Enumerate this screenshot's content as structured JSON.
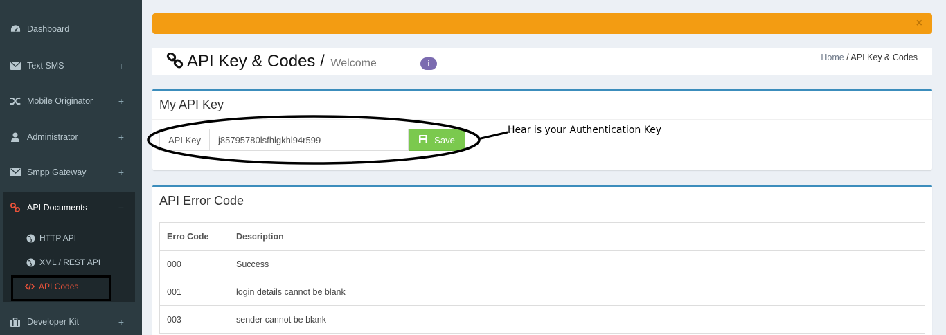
{
  "sidebar": {
    "items": [
      {
        "label": "Dashboard",
        "icon": "dashboard-icon"
      },
      {
        "label": "Text SMS",
        "icon": "envelope-icon",
        "toggle": "+"
      },
      {
        "label": "Mobile Originator",
        "icon": "shuffle-icon",
        "toggle": "+"
      },
      {
        "label": "Administrator",
        "icon": "user-icon",
        "toggle": "+"
      },
      {
        "label": "Smpp Gateway",
        "icon": "envelope-icon",
        "toggle": "+"
      },
      {
        "label": "API Documents",
        "icon": "link-icon",
        "toggle": "−"
      },
      {
        "label": "Developer Kit",
        "icon": "briefcase-icon",
        "toggle": "+"
      }
    ],
    "submenu": [
      {
        "label": "HTTP API",
        "icon": "globe-icon"
      },
      {
        "label": "XML / REST API",
        "icon": "globe-icon"
      },
      {
        "label": "API Codes",
        "icon": "code-icon",
        "active": true
      }
    ]
  },
  "alert": {
    "close": "×",
    "color": "#f39c12"
  },
  "header": {
    "title": "API Key & Codes /",
    "subtitle": "Welcome",
    "info": "i",
    "breadcrumb": {
      "home": "Home",
      "separator": " / ",
      "current": "API Key & Codes"
    }
  },
  "api_key_box": {
    "title": "My API Key",
    "addon": "API Key",
    "value": "j85795780lsfhlgkhl94r599",
    "save": "Save"
  },
  "annotation": "Hear is your Authentication Key",
  "error_box": {
    "title": "API Error Code",
    "columns": [
      "Erro Code",
      "Description"
    ],
    "rows": [
      {
        "code": "000",
        "desc": "Success"
      },
      {
        "code": "001",
        "desc": "login details cannot be blank"
      },
      {
        "code": "003",
        "desc": "sender cannot be blank"
      }
    ]
  },
  "colors": {
    "sidebar": "#2c3b41",
    "accent": "#3c8dbc",
    "save": "#7bc94e",
    "active": "#e8523a"
  }
}
